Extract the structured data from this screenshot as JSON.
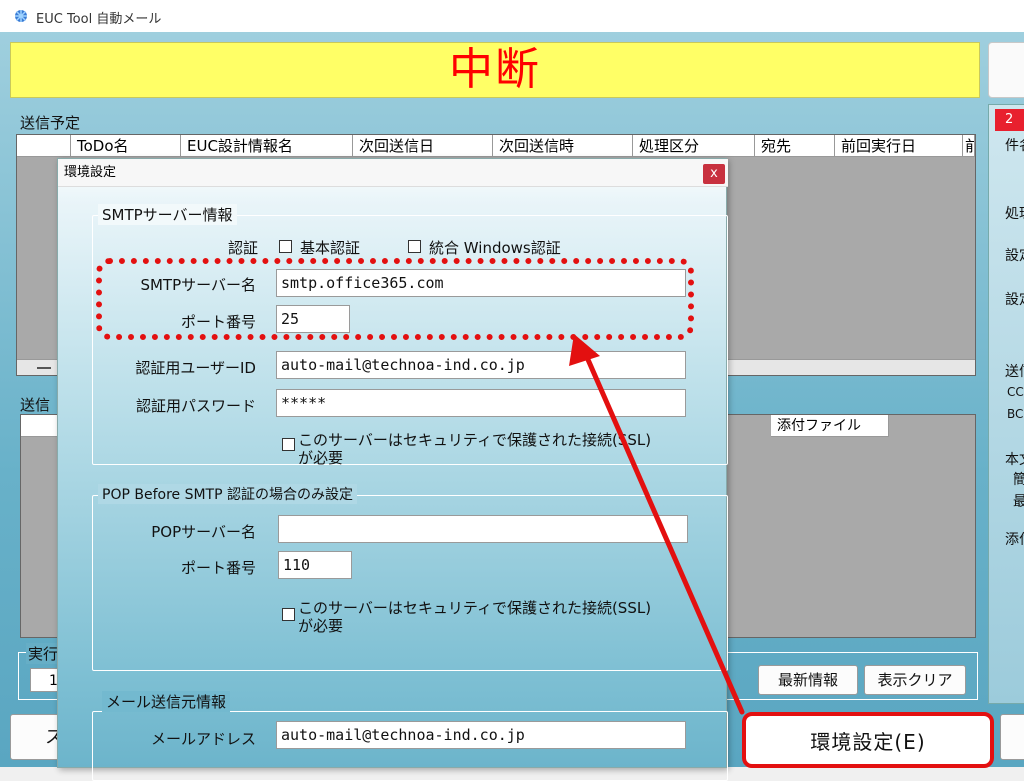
{
  "window": {
    "title": "EUC Tool 自動メール",
    "banner": "中断"
  },
  "schedule": {
    "label": "送信予定",
    "columns": [
      "ToDo名",
      "EUC設計情報名",
      "次回送信日",
      "次回送信時",
      "処理区分",
      "宛先",
      "前回実行日",
      "前"
    ]
  },
  "history": {
    "label": "送信",
    "attachment_col": "添付ファイル"
  },
  "exec": {
    "label": "実行",
    "value": "1"
  },
  "buttons": {
    "latest": "最新情報",
    "clear": "表示クリア",
    "left_partial": "ス",
    "env": "環境設定(E)"
  },
  "right_panel": {
    "items": [
      "2",
      "件名",
      "処理",
      "設定",
      "設定",
      "送信",
      "CC",
      "BCC",
      "本文",
      "簡",
      "最",
      "添付"
    ]
  },
  "dialog": {
    "title": "環境設定",
    "close": "x",
    "smtp_group": "SMTPサーバー情報",
    "auth_label": "認証",
    "auth_basic": "基本認証",
    "auth_windows": "統合 Windows認証",
    "smtp_server_label": "SMTPサーバー名",
    "smtp_server_value": "smtp.office365.com",
    "port_label": "ポート番号",
    "port_value": "25",
    "auth_user_label": "認証用ユーザーID",
    "auth_user_value": "auto-mail@technoa-ind.co.jp",
    "auth_pw_label": "認証用パスワード",
    "auth_pw_value": "*****",
    "ssl_line1": "このサーバーはセキュリティで保護された接続(SSL)",
    "ssl_line2": "が必要",
    "pop_group": "POP Before SMTP 認証の場合のみ設定",
    "pop_server_label": "POPサーバー名",
    "pop_server_value": "",
    "pop_port_label": "ポート番号",
    "pop_port_value": "110",
    "pop_ssl_line1": "このサーバーはセキュリティで保護された接続(SSL)",
    "pop_ssl_line2": "が必要",
    "mail_group": "メール送信元情報",
    "mail_addr_label": "メールアドレス",
    "mail_addr_value": "auto-mail@technoa-ind.co.jp"
  },
  "colors": {
    "banner_bg": "#ffff66",
    "banner_text": "#ff0000",
    "annotation": "#e31010"
  }
}
